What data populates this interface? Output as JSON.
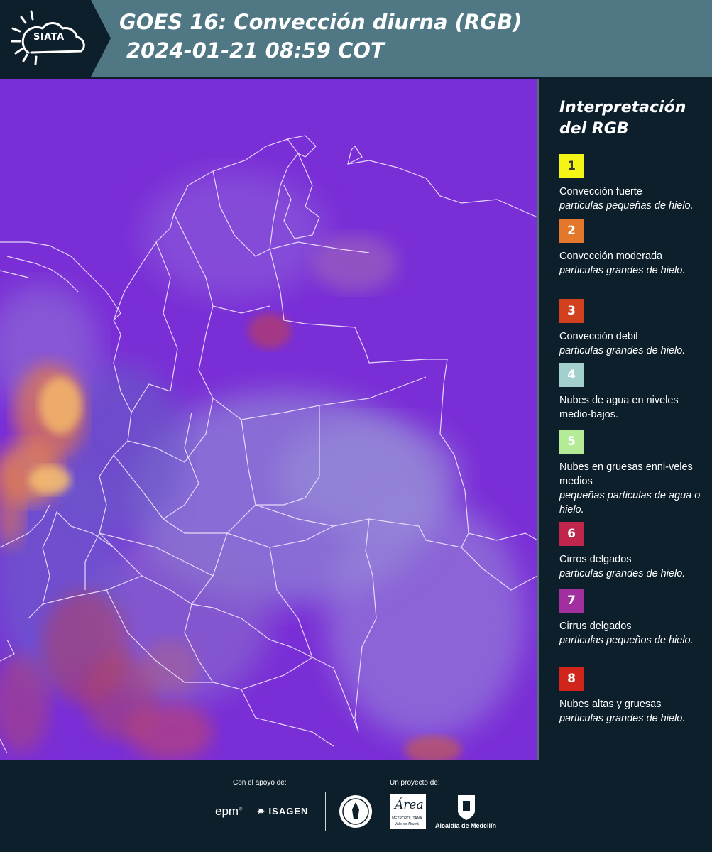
{
  "header": {
    "logo_text": "SIATA",
    "title_line1": "GOES 16: Convección diurna (RGB)",
    "title_line2": "2024-01-21 08:59 COT"
  },
  "colors": {
    "header_bg": "#4f7784",
    "panel_bg": "#0c1f2b",
    "map_base": "#7b2fd8"
  },
  "legend": {
    "title": "Interpretación del RGB",
    "items": [
      {
        "num": "1",
        "color": "#f4f415",
        "text_color": "#333333",
        "name": "Convección fuerte",
        "desc": "particulas pequeñas de hielo."
      },
      {
        "num": "2",
        "color": "#e4782a",
        "text_color": "#ffffff",
        "name": "Convección moderada",
        "desc": "particulas grandes de hielo."
      },
      {
        "num": "3",
        "color": "#d2401e",
        "text_color": "#ffffff",
        "name": "Convección debil",
        "desc": "particulas grandes de hielo."
      },
      {
        "num": "4",
        "color": "#a3cfcd",
        "text_color": "#ffffff",
        "name": "Nubes de agua en niveles medio-bajos.",
        "desc": ""
      },
      {
        "num": "5",
        "color": "#b3eb97",
        "text_color": "#ffffff",
        "name": "Nubes en gruesas enni-veles medios",
        "desc": "pequeñas particulas de agua o hielo."
      },
      {
        "num": "6",
        "color": "#c0254c",
        "text_color": "#ffffff",
        "name": "Cirros delgados",
        "desc": "particulas grandes de hielo."
      },
      {
        "num": "7",
        "color": "#a22fa0",
        "text_color": "#ffffff",
        "name": "Cirrus delgados",
        "desc": "particulas pequeños de hielo."
      },
      {
        "num": "8",
        "color": "#d1251c",
        "text_color": "#ffffff",
        "name": "Nubes altas y gruesas",
        "desc": "particulas grandes de hielo."
      }
    ]
  },
  "footer": {
    "support_label": "Con el apoyo de:",
    "project_label": "Un proyecto de:",
    "sponsor_epm": "epm",
    "sponsor_isagen": "ISAGEN",
    "org_area": "Área",
    "org_area_sub1": "METROPOLITANA",
    "org_area_sub2": "Valle de Aburrá",
    "org_alcaldia": "Alcaldía de Medellín"
  }
}
